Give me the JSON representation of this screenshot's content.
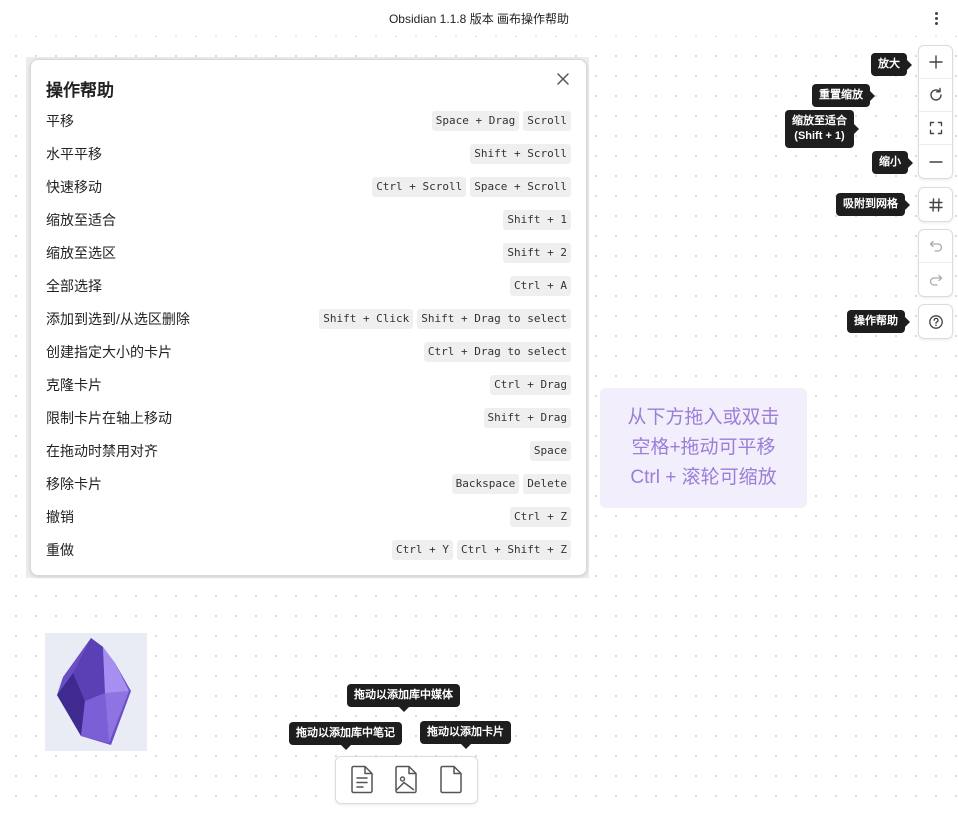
{
  "window": {
    "title": "Obsidian 1.1.8 版本 画布操作帮助"
  },
  "help": {
    "title": "操作帮助",
    "rows": [
      {
        "label": "平移",
        "keys": [
          "Space + Drag",
          "Scroll"
        ]
      },
      {
        "label": "水平平移",
        "keys": [
          "Shift + Scroll"
        ]
      },
      {
        "label": "快速移动",
        "keys": [
          "Ctrl + Scroll",
          "Space + Scroll"
        ]
      },
      {
        "label": "缩放至适合",
        "keys": [
          "Shift + 1"
        ]
      },
      {
        "label": "缩放至选区",
        "keys": [
          "Shift + 2"
        ]
      },
      {
        "label": "全部选择",
        "keys": [
          "Ctrl + A"
        ]
      },
      {
        "label": "添加到选到/从选区删除",
        "keys": [
          "Shift + Click",
          "Shift + Drag to select"
        ]
      },
      {
        "label": "创建指定大小的卡片",
        "keys": [
          "Ctrl + Drag to select"
        ]
      },
      {
        "label": "克隆卡片",
        "keys": [
          "Ctrl + Drag"
        ]
      },
      {
        "label": "限制卡片在轴上移动",
        "keys": [
          "Shift + Drag"
        ]
      },
      {
        "label": "在拖动时禁用对齐",
        "keys": [
          "Space"
        ]
      },
      {
        "label": "移除卡片",
        "keys": [
          "Backspace",
          "Delete"
        ]
      },
      {
        "label": "撤销",
        "keys": [
          "Ctrl + Z"
        ]
      },
      {
        "label": "重做",
        "keys": [
          "Ctrl + Y",
          "Ctrl + Shift + Z"
        ]
      }
    ]
  },
  "hint": {
    "line1": "从下方拖入或双击",
    "line2": "空格+拖动可平移",
    "line3": "Ctrl + 滚轮可缩放"
  },
  "tooltips": {
    "zoom_in": "放大",
    "reset_zoom": "重置缩放",
    "zoom_fit_line1": "缩放至适合",
    "zoom_fit_line2": "(Shift + 1)",
    "zoom_out": "缩小",
    "snap_grid": "吸附到网格",
    "help": "操作帮助",
    "add_media": "拖动以添加库中媒体",
    "add_note": "拖动以添加库中笔记",
    "add_card": "拖动以添加卡片"
  },
  "icons": {
    "zoom_in": "plus-icon",
    "reset_zoom": "rotate-cw-icon",
    "zoom_fit": "maximize-icon",
    "zoom_out": "minus-icon",
    "snap_grid": "grid-hash-icon",
    "undo": "undo-icon",
    "redo": "redo-icon",
    "help": "help-circle-icon",
    "note": "file-text-icon",
    "media": "file-image-icon",
    "card": "file-icon",
    "logo": "obsidian-logo",
    "close": "close-icon",
    "more": "more-vertical-icon"
  },
  "colors": {
    "accent": "#7c5cd6",
    "hint_text": "#9b7ed8",
    "hint_bg": "#f2eefc",
    "tooltip_bg": "#1e1e1e"
  }
}
